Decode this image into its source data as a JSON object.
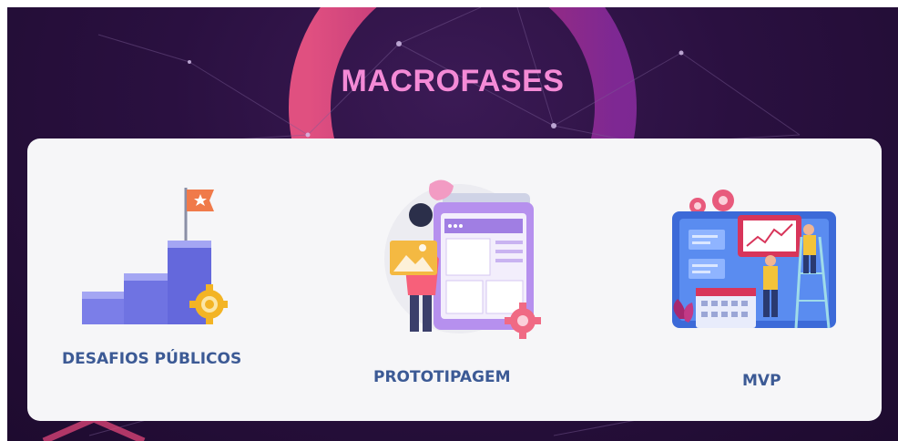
{
  "header": {
    "title": "MACROFASES"
  },
  "phases": [
    {
      "label": "DESAFIOS PÚBLICOS",
      "icon": "stairs-flag-gear-icon"
    },
    {
      "label": "PROTOTIPAGEM",
      "icon": "prototype-screens-person-icon"
    },
    {
      "label": "MVP",
      "icon": "mvp-dashboard-team-icon"
    }
  ],
  "colors": {
    "background": "#2a1040",
    "title": "#f48ad6",
    "card": "#f6f6f8",
    "label": "#3c5a95",
    "accent_pink": "#e0457a",
    "accent_purple": "#8b5cf6"
  }
}
